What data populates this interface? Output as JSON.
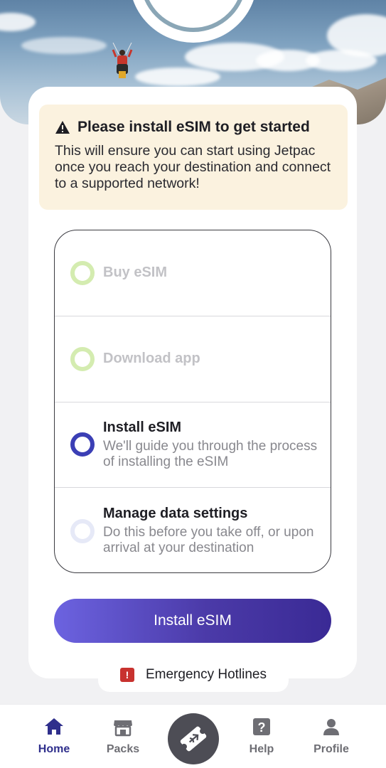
{
  "notice": {
    "title": "Please install eSIM to get started",
    "body": "This will ensure you can start using Jetpac once you reach your destination and connect to a supported network!",
    "icon": "warning-icon"
  },
  "steps": [
    {
      "title": "Buy eSIM",
      "desc": "",
      "state": "done"
    },
    {
      "title": "Download app",
      "desc": "",
      "state": "done"
    },
    {
      "title": "Install eSIM",
      "desc": "We'll guide you through the process of installing the eSIM",
      "state": "active"
    },
    {
      "title": "Manage data settings",
      "desc": "Do this before you take off, or upon arrival at your destination",
      "state": "pending"
    }
  ],
  "install_button": "Install eSIM",
  "hotlines": {
    "label": "Emergency Hotlines",
    "icon": "!"
  },
  "nav": {
    "items": [
      {
        "label": "Home",
        "icon": "home-icon",
        "active": true
      },
      {
        "label": "Packs",
        "icon": "store-icon",
        "active": false
      },
      {
        "label": "Help",
        "icon": "help-icon",
        "active": false
      },
      {
        "label": "Profile",
        "icon": "profile-icon",
        "active": false
      }
    ],
    "center_icon": "ticket-plane-icon"
  },
  "colors": {
    "accent": "#3b3fb5",
    "done": "#d4ecb0",
    "notice_bg": "#fbf2df",
    "button_start": "#6c63e0",
    "button_end": "#3a2a95"
  }
}
